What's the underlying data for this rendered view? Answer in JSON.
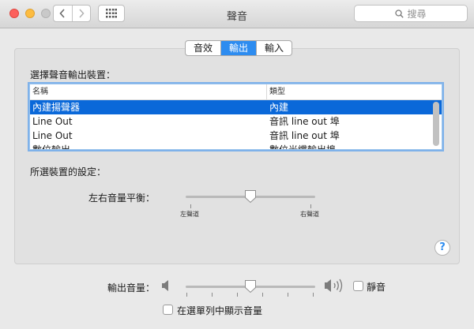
{
  "window": {
    "title": "聲音"
  },
  "search": {
    "placeholder": "搜尋"
  },
  "icons": {
    "back": "chevron-left-icon",
    "forward": "chevron-right-icon",
    "grid": "grid-icon",
    "search": "search-icon",
    "speaker_low": "speaker-low-icon",
    "speaker_high": "speaker-high-icon",
    "help": "help-icon"
  },
  "colors": {
    "accent": "#2d8cf0",
    "selection": "#0a68d9"
  },
  "tabs": [
    {
      "label": "音效"
    },
    {
      "label": "輸出",
      "active": true
    },
    {
      "label": "輸入"
    }
  ],
  "output": {
    "heading": "選擇聲音輸出裝置：",
    "columns": {
      "name": "名稱",
      "type": "類型"
    },
    "devices": [
      {
        "name": "內建揚聲器",
        "type": "內建",
        "selected": true
      },
      {
        "name": "Line Out",
        "type": "音訊 line out 埠"
      },
      {
        "name": "Line Out",
        "type": "音訊 line out 埠"
      },
      {
        "name": "數位輸出",
        "type": "數位光纖輸出埠"
      }
    ]
  },
  "settings": {
    "heading": "所選裝置的設定：",
    "balance": {
      "label": "左右音量平衡：",
      "left_label": "左聲道",
      "right_label": "右聲道",
      "value": 0.5
    }
  },
  "volume": {
    "label": "輸出音量：",
    "value": 0.5,
    "mute_label": "靜音",
    "mute_checked": false
  },
  "show_in_menu": {
    "label": "在選單列中顯示音量",
    "checked": false
  },
  "help": {
    "label": "?"
  }
}
